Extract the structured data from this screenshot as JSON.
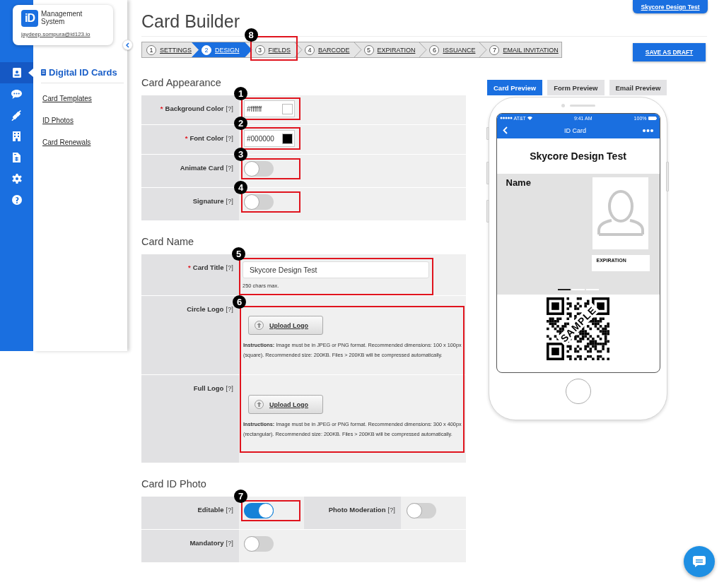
{
  "app": {
    "logo": "iD",
    "name": "Management System",
    "email": "jaydeep.sompura@id123.io"
  },
  "rail": [
    {
      "kind": "id-card",
      "selected": true
    },
    {
      "kind": "chat",
      "selected": false
    },
    {
      "kind": "plug",
      "selected": false
    },
    {
      "kind": "building",
      "selected": false
    },
    {
      "kind": "invoice",
      "selected": false
    },
    {
      "kind": "gear",
      "selected": false
    },
    {
      "kind": "support",
      "selected": false
    }
  ],
  "sidebar": {
    "heading": "Digital ID Cards",
    "links": [
      "Card Templates",
      "ID Photos",
      "Card Renewals"
    ]
  },
  "page_title": "Card Builder",
  "account_button": "Skycore Design Test",
  "steps": [
    {
      "number": "1",
      "label": "SETTINGS",
      "selected": false
    },
    {
      "number": "2",
      "label": "DESIGN",
      "selected": true
    },
    {
      "number": "3",
      "label": "FIELDS",
      "selected": false,
      "callout": "8"
    },
    {
      "number": "4",
      "label": "BARCODE",
      "selected": false
    },
    {
      "number": "5",
      "label": "EXPIRATION",
      "selected": false
    },
    {
      "number": "6",
      "label": "ISSUANCE",
      "selected": false
    },
    {
      "number": "7",
      "label": "EMAIL INVITATION",
      "selected": false
    }
  ],
  "save_button": "SAVE AS DRAFT",
  "required_mark": "*",
  "sections": [
    {
      "title": "Card Appearance",
      "rows": [
        {
          "kind": "color",
          "label": "Background Color",
          "help": "[?]",
          "required": true,
          "value": "#ffffff",
          "color": "#ffffff",
          "callout": "1"
        },
        {
          "kind": "color",
          "label": "Font Color",
          "help": "[?]",
          "required": true,
          "value": "#000000",
          "color": "#000000",
          "callout": "2"
        },
        {
          "kind": "toggle",
          "label": "Animate Card",
          "help": "[?]",
          "on": false,
          "callout": "3"
        },
        {
          "kind": "toggle",
          "label": "Signature",
          "help": "[?]",
          "on": false,
          "callout": "4"
        }
      ]
    },
    {
      "title": "Card Name",
      "rows": [
        {
          "kind": "text",
          "label": "Card Title",
          "help": "[?]",
          "required": true,
          "value": "Skycore Design Test",
          "hint": "250 chars max.",
          "callout": "5"
        },
        {
          "kind": "upload_group",
          "callout": "6",
          "items": [
            {
              "label": "Circle Logo",
              "help": "[?]",
              "button": "Upload Logo",
              "instructions": "**Instructions:** Image must be in JPEG or PNG format. Recommended dimensions: 100 x 100px (square). Recommended size: 200KB. Files > 200KB will be compressed automatically."
            },
            {
              "label": "Full Logo",
              "help": "[?]",
              "button": "Upload Logo",
              "instructions": "**Instructions:** Image must be in JPEG or PNG format. Recommended dimensions: 300 x 400px (rectangular). Recommended size: 200KB. Files > 200KB will be compressed automatically."
            }
          ]
        }
      ]
    },
    {
      "title": "Card ID Photo",
      "rows": [
        {
          "kind": "toggle_pair",
          "items": [
            {
              "label": "Editable",
              "help": "[?]",
              "on": true,
              "callout": "7"
            },
            {
              "label": "Photo Moderation",
              "help": "[?]",
              "on": false
            }
          ]
        },
        {
          "kind": "toggle",
          "label": "Mandatory",
          "help": "[?]",
          "on": false
        }
      ]
    }
  ],
  "preview_tabs": [
    {
      "label": "Card Preview",
      "selected": true
    },
    {
      "label": "Form Preview",
      "selected": false
    },
    {
      "label": "Email Preview",
      "selected": false
    }
  ],
  "phone": {
    "carrier": "AT&T",
    "time": "9:41 AM",
    "battery": "100%",
    "nav_title": "ID Card",
    "card_title": "Skycore Design Test",
    "name_label": "Name",
    "expiration_label": "EXPIRATION",
    "stamp": "SAMPLE",
    "page_dots": [
      {
        "selected": true
      },
      {
        "selected": false
      },
      {
        "selected": false
      }
    ]
  }
}
